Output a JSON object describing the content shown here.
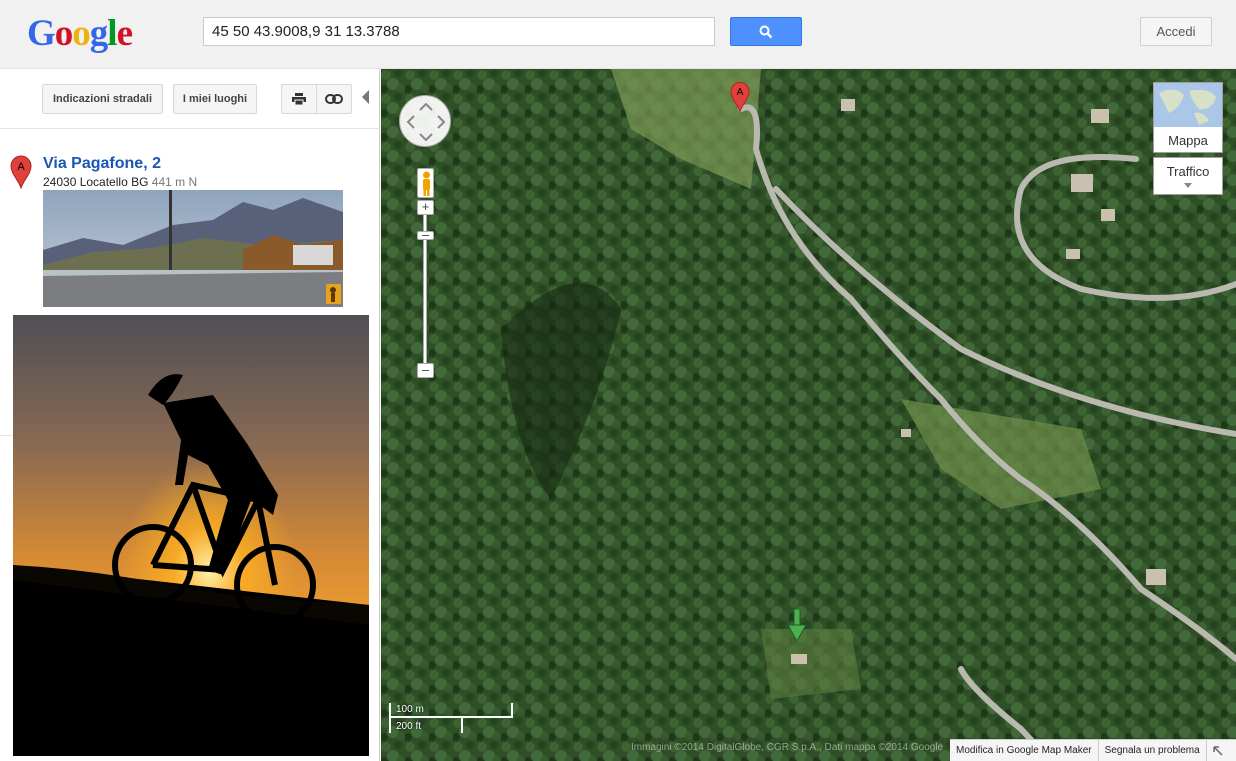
{
  "header": {
    "logo_letters": [
      {
        "ch": "G",
        "color": "#3369e8"
      },
      {
        "ch": "o",
        "color": "#d50f25"
      },
      {
        "ch": "o",
        "color": "#eeb211"
      },
      {
        "ch": "g",
        "color": "#3369e8"
      },
      {
        "ch": "l",
        "color": "#009925"
      },
      {
        "ch": "e",
        "color": "#d50f25"
      }
    ],
    "search_value": "45 50 43.9008,9 31 13.3788",
    "search_button_icon": "search-icon",
    "signin_label": "Accedi"
  },
  "sidebar": {
    "directions_label": "Indicazioni stradali",
    "my_places_label": "I miei luoghi",
    "print_icon": "print-icon",
    "link_icon": "link-icon",
    "result": {
      "marker": "A",
      "title": "Via Pagafone, 2",
      "address": "24030 Locatello BG",
      "distance": "441 m N"
    }
  },
  "map": {
    "marker_label": "A",
    "map_type_label": "Mappa",
    "traffic_label": "Traffico",
    "scale_metric": "100 m",
    "scale_imperial": "200 ft",
    "attribution": "Immagini ©2014 DigitalGlobe, CGR S.p.A., Dati mappa ©2014 Google",
    "mapmaker_label": "Modifica in Google Map Maker",
    "report_label": "Segnala un problema"
  },
  "colors": {
    "accent": "#4d90fe",
    "link": "#1a56b5",
    "marker_red": "#e0403a",
    "marker_green": "#4caf50"
  }
}
